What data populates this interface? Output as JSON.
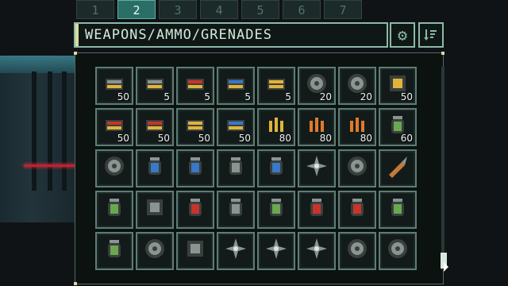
{
  "tabs": [
    "1",
    "2",
    "3",
    "4",
    "5",
    "6",
    "7"
  ],
  "active_tab": 1,
  "header": {
    "title": "WEAPONS/AMMO/GRENADES"
  },
  "icons": {
    "settings": "gear-icon",
    "sort": "sort-icon"
  },
  "colors": {
    "accent": "#8db9a6",
    "tab_active": "#2a6e66",
    "title_bar": "#d8dba0"
  },
  "items": [
    {
      "name": "shotgun-shell-cluster-icon",
      "qty": "50"
    },
    {
      "name": "rifle-magazine-bundle-icon",
      "qty": "5"
    },
    {
      "name": "red-magazine-bundle-icon",
      "qty": "5"
    },
    {
      "name": "blue-magazine-bundle-icon",
      "qty": "5"
    },
    {
      "name": "yellow-magazine-bundle-icon",
      "qty": "5"
    },
    {
      "name": "saw-blade-icon",
      "qty": "20"
    },
    {
      "name": "rusty-saw-blade-icon",
      "qty": "20"
    },
    {
      "name": "dart-bundle-icon",
      "qty": "50"
    },
    {
      "name": "red-ammo-pack-icon",
      "qty": "50"
    },
    {
      "name": "red-ammo-cluster-icon",
      "qty": "50"
    },
    {
      "name": "yellow-ammo-pack-icon",
      "qty": "50"
    },
    {
      "name": "blue-ammo-pack-icon",
      "qty": "50"
    },
    {
      "name": "bullets-icon",
      "qty": "80"
    },
    {
      "name": "orange-bullets-icon",
      "qty": "80"
    },
    {
      "name": "copper-bullets-icon",
      "qty": "80"
    },
    {
      "name": "green-canister-icon",
      "qty": "60"
    },
    {
      "name": "proximity-mine-icon",
      "qty": ""
    },
    {
      "name": "cryo-grenade-icon",
      "qty": ""
    },
    {
      "name": "emp-grenade-icon",
      "qty": ""
    },
    {
      "name": "frag-grenade-icon",
      "qty": ""
    },
    {
      "name": "blue-grenade-icon",
      "qty": ""
    },
    {
      "name": "claw-icon",
      "qty": ""
    },
    {
      "name": "spike-mine-icon",
      "qty": ""
    },
    {
      "name": "rocket-icon",
      "qty": ""
    },
    {
      "name": "plasma-canister-icon",
      "qty": ""
    },
    {
      "name": "circuit-board-icon",
      "qty": ""
    },
    {
      "name": "fire-bomb-icon",
      "qty": ""
    },
    {
      "name": "smoke-grenade-icon",
      "qty": ""
    },
    {
      "name": "gas-grenade-icon",
      "qty": ""
    },
    {
      "name": "incendiary-grenade-icon",
      "qty": ""
    },
    {
      "name": "heart-bomb-icon",
      "qty": ""
    },
    {
      "name": "acid-grenade-icon",
      "qty": ""
    },
    {
      "name": "battery-cell-icon",
      "qty": ""
    },
    {
      "name": "rusty-disc-icon",
      "qty": ""
    },
    {
      "name": "armor-plate-icon",
      "qty": ""
    },
    {
      "name": "feather-blades-icon",
      "qty": ""
    },
    {
      "name": "caltrops-icon",
      "qty": ""
    },
    {
      "name": "shuriken-icon",
      "qty": ""
    },
    {
      "name": "drone-icon",
      "qty": ""
    },
    {
      "name": "spark-mine-icon",
      "qty": ""
    }
  ]
}
